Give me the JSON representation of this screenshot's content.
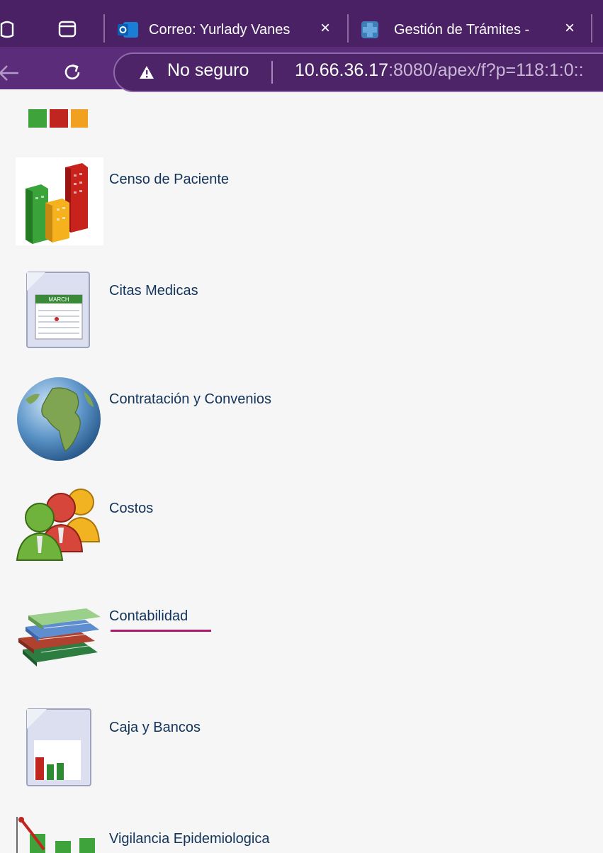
{
  "browser": {
    "tabs": [
      {
        "label": "Correo: Yurlady Vanes",
        "icon": "outlook-icon"
      },
      {
        "label": "Gestión de Trámites -",
        "icon": "site-favicon"
      }
    ],
    "close_glyph": "×",
    "security_label": "No seguro",
    "url_host": "10.66.36.17",
    "url_rest": ":8080/apex/f?p=118:1:0::"
  },
  "menu": {
    "items": [
      {
        "label": "Censo de Paciente",
        "icon": "buildings-icon"
      },
      {
        "label": "Citas Medicas",
        "icon": "calendar-icon",
        "calendar_month": "MARCH"
      },
      {
        "label": "Contratación y Convenios",
        "icon": "globe-icon"
      },
      {
        "label": "Costos",
        "icon": "people-icon"
      },
      {
        "label": "Contabilidad",
        "icon": "books-icon"
      },
      {
        "label": "Caja y Bancos",
        "icon": "report-chart-icon"
      },
      {
        "label": "Vigilancia Epidemiologica",
        "icon": "trend-chart-icon"
      }
    ]
  },
  "colors": {
    "tabbar": "#4b2166",
    "addressbar": "#5a2c7a",
    "link": "#12345a",
    "hover_underline": "#b1176b"
  }
}
